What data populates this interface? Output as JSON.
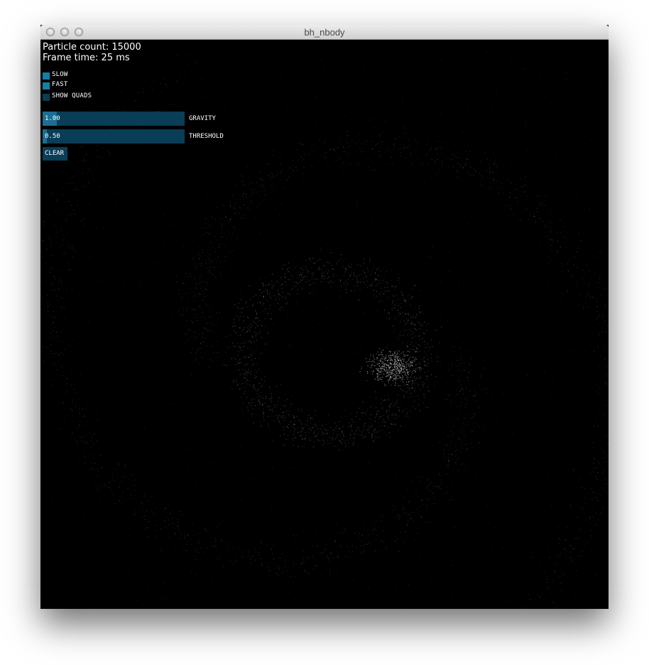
{
  "window": {
    "title": "bh_nbody"
  },
  "stats": {
    "particle_count": "Particle count: 15000",
    "frame_time": "Frame time: 25 ms"
  },
  "toggles": [
    {
      "label": "SLOW",
      "checked": true
    },
    {
      "label": "FAST",
      "checked": true
    },
    {
      "label": "SHOW QUADS",
      "checked": false
    }
  ],
  "sliders": {
    "gravity": {
      "value": "1.00",
      "label": "GRAVITY",
      "fill": 0.1
    },
    "threshold": {
      "value": "0.50",
      "label": "THRESHOLD",
      "fill": 0.03
    }
  },
  "buttons": {
    "clear": "CLEAR"
  },
  "colors": {
    "control_bg": "#0a3d56",
    "control_active": "#1480a8",
    "slider_fill": "#1b6e92",
    "canvas_bg": "#000000",
    "particle": "#ffffff"
  }
}
